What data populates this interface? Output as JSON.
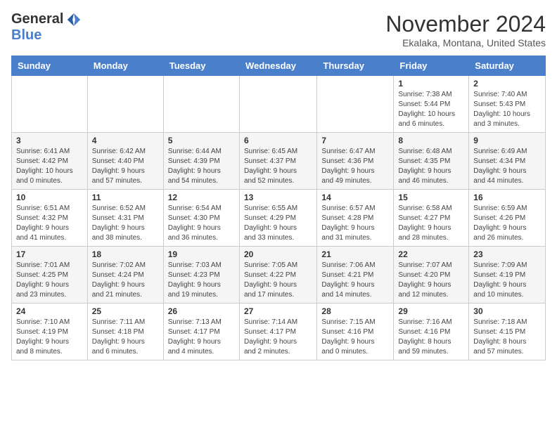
{
  "header": {
    "logo_general": "General",
    "logo_blue": "Blue",
    "month_title": "November 2024",
    "location": "Ekalaka, Montana, United States"
  },
  "days_of_week": [
    "Sunday",
    "Monday",
    "Tuesday",
    "Wednesday",
    "Thursday",
    "Friday",
    "Saturday"
  ],
  "weeks": [
    [
      {
        "day": "",
        "info": ""
      },
      {
        "day": "",
        "info": ""
      },
      {
        "day": "",
        "info": ""
      },
      {
        "day": "",
        "info": ""
      },
      {
        "day": "",
        "info": ""
      },
      {
        "day": "1",
        "info": "Sunrise: 7:38 AM\nSunset: 5:44 PM\nDaylight: 10 hours\nand 6 minutes."
      },
      {
        "day": "2",
        "info": "Sunrise: 7:40 AM\nSunset: 5:43 PM\nDaylight: 10 hours\nand 3 minutes."
      }
    ],
    [
      {
        "day": "3",
        "info": "Sunrise: 6:41 AM\nSunset: 4:42 PM\nDaylight: 10 hours\nand 0 minutes."
      },
      {
        "day": "4",
        "info": "Sunrise: 6:42 AM\nSunset: 4:40 PM\nDaylight: 9 hours\nand 57 minutes."
      },
      {
        "day": "5",
        "info": "Sunrise: 6:44 AM\nSunset: 4:39 PM\nDaylight: 9 hours\nand 54 minutes."
      },
      {
        "day": "6",
        "info": "Sunrise: 6:45 AM\nSunset: 4:37 PM\nDaylight: 9 hours\nand 52 minutes."
      },
      {
        "day": "7",
        "info": "Sunrise: 6:47 AM\nSunset: 4:36 PM\nDaylight: 9 hours\nand 49 minutes."
      },
      {
        "day": "8",
        "info": "Sunrise: 6:48 AM\nSunset: 4:35 PM\nDaylight: 9 hours\nand 46 minutes."
      },
      {
        "day": "9",
        "info": "Sunrise: 6:49 AM\nSunset: 4:34 PM\nDaylight: 9 hours\nand 44 minutes."
      }
    ],
    [
      {
        "day": "10",
        "info": "Sunrise: 6:51 AM\nSunset: 4:32 PM\nDaylight: 9 hours\nand 41 minutes."
      },
      {
        "day": "11",
        "info": "Sunrise: 6:52 AM\nSunset: 4:31 PM\nDaylight: 9 hours\nand 38 minutes."
      },
      {
        "day": "12",
        "info": "Sunrise: 6:54 AM\nSunset: 4:30 PM\nDaylight: 9 hours\nand 36 minutes."
      },
      {
        "day": "13",
        "info": "Sunrise: 6:55 AM\nSunset: 4:29 PM\nDaylight: 9 hours\nand 33 minutes."
      },
      {
        "day": "14",
        "info": "Sunrise: 6:57 AM\nSunset: 4:28 PM\nDaylight: 9 hours\nand 31 minutes."
      },
      {
        "day": "15",
        "info": "Sunrise: 6:58 AM\nSunset: 4:27 PM\nDaylight: 9 hours\nand 28 minutes."
      },
      {
        "day": "16",
        "info": "Sunrise: 6:59 AM\nSunset: 4:26 PM\nDaylight: 9 hours\nand 26 minutes."
      }
    ],
    [
      {
        "day": "17",
        "info": "Sunrise: 7:01 AM\nSunset: 4:25 PM\nDaylight: 9 hours\nand 23 minutes."
      },
      {
        "day": "18",
        "info": "Sunrise: 7:02 AM\nSunset: 4:24 PM\nDaylight: 9 hours\nand 21 minutes."
      },
      {
        "day": "19",
        "info": "Sunrise: 7:03 AM\nSunset: 4:23 PM\nDaylight: 9 hours\nand 19 minutes."
      },
      {
        "day": "20",
        "info": "Sunrise: 7:05 AM\nSunset: 4:22 PM\nDaylight: 9 hours\nand 17 minutes."
      },
      {
        "day": "21",
        "info": "Sunrise: 7:06 AM\nSunset: 4:21 PM\nDaylight: 9 hours\nand 14 minutes."
      },
      {
        "day": "22",
        "info": "Sunrise: 7:07 AM\nSunset: 4:20 PM\nDaylight: 9 hours\nand 12 minutes."
      },
      {
        "day": "23",
        "info": "Sunrise: 7:09 AM\nSunset: 4:19 PM\nDaylight: 9 hours\nand 10 minutes."
      }
    ],
    [
      {
        "day": "24",
        "info": "Sunrise: 7:10 AM\nSunset: 4:19 PM\nDaylight: 9 hours\nand 8 minutes."
      },
      {
        "day": "25",
        "info": "Sunrise: 7:11 AM\nSunset: 4:18 PM\nDaylight: 9 hours\nand 6 minutes."
      },
      {
        "day": "26",
        "info": "Sunrise: 7:13 AM\nSunset: 4:17 PM\nDaylight: 9 hours\nand 4 minutes."
      },
      {
        "day": "27",
        "info": "Sunrise: 7:14 AM\nSunset: 4:17 PM\nDaylight: 9 hours\nand 2 minutes."
      },
      {
        "day": "28",
        "info": "Sunrise: 7:15 AM\nSunset: 4:16 PM\nDaylight: 9 hours\nand 0 minutes."
      },
      {
        "day": "29",
        "info": "Sunrise: 7:16 AM\nSunset: 4:16 PM\nDaylight: 8 hours\nand 59 minutes."
      },
      {
        "day": "30",
        "info": "Sunrise: 7:18 AM\nSunset: 4:15 PM\nDaylight: 8 hours\nand 57 minutes."
      }
    ]
  ]
}
